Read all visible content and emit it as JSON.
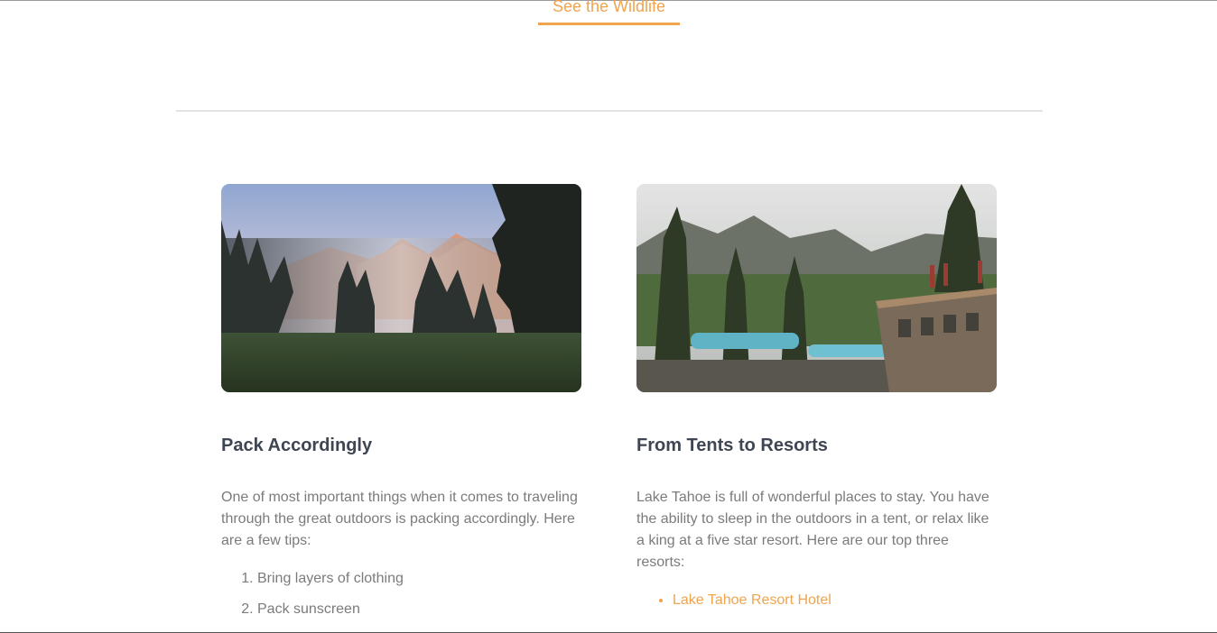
{
  "header": {
    "wildlife_link": "See the Wildlife"
  },
  "cards": [
    {
      "image_alt": "misty mountain meadow at sunrise",
      "title": "Pack Accordingly",
      "body": "One of most important things when it comes to traveling through the great outdoors is packing accordingly. Here are a few tips:",
      "list_type": "ordered",
      "items": [
        "Bring layers of clothing",
        "Pack sunscreen"
      ]
    },
    {
      "image_alt": "resort pools among pine trees",
      "title": "From Tents to Resorts",
      "body": "Lake Tahoe is full of wonderful places to stay. You have the ability to sleep in the outdoors in a tent, or relax like a king at a five star resort. Here are our top three resorts:",
      "list_type": "unordered",
      "items": [
        "Lake Tahoe Resort Hotel"
      ]
    }
  ],
  "colors": {
    "accent": "#f0a44e",
    "heading": "#3e4653",
    "body_text": "#7b7b7b",
    "divider": "#e3e3e3"
  }
}
